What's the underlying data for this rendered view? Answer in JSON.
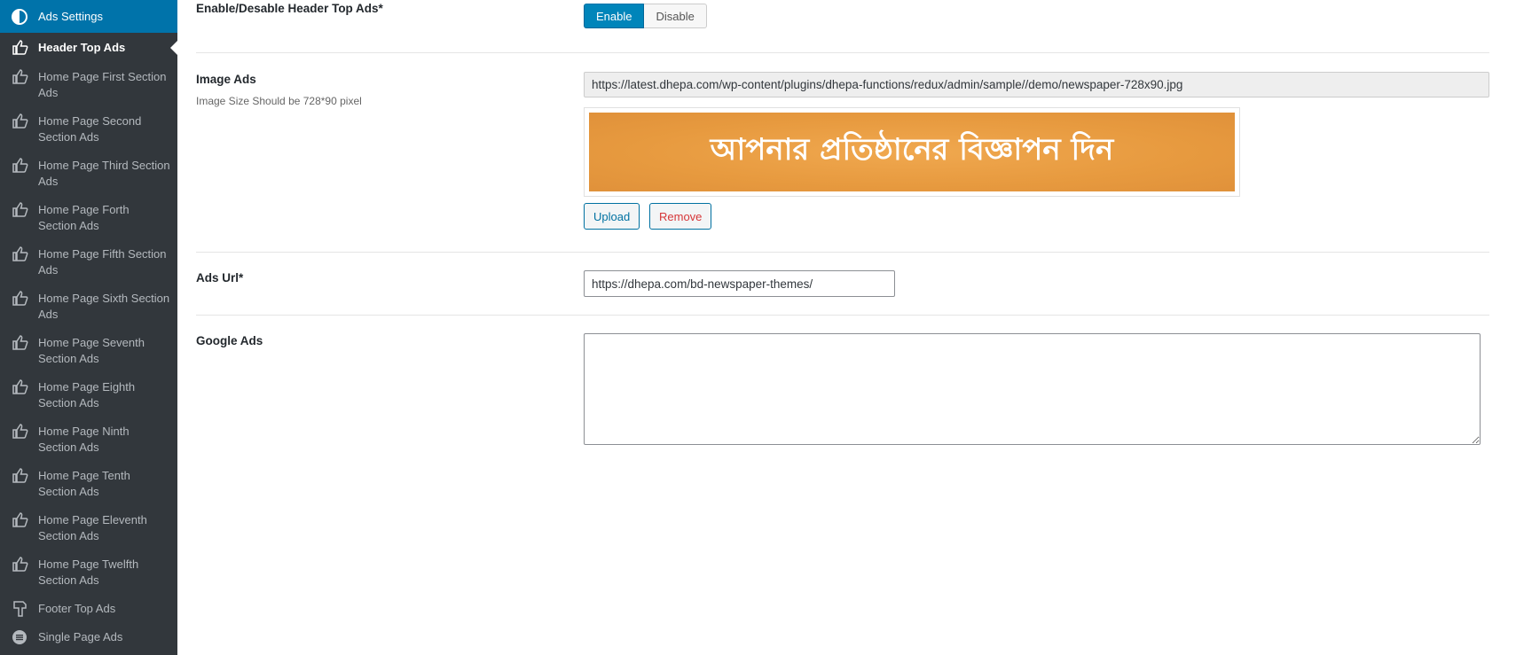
{
  "sidebar": {
    "header": {
      "label": "Ads Settings",
      "icon": "half-circle-icon"
    },
    "items": [
      {
        "label": "Header Top Ads",
        "icon": "thumb-pointer-icon",
        "active": true
      },
      {
        "label": "Home Page First Section Ads",
        "icon": "thumb-pointer-icon"
      },
      {
        "label": "Home Page Second Section Ads",
        "icon": "thumb-pointer-icon"
      },
      {
        "label": "Home Page Third Section Ads",
        "icon": "thumb-pointer-icon"
      },
      {
        "label": "Home Page Forth Section Ads",
        "icon": "thumb-pointer-icon"
      },
      {
        "label": "Home Page Fifth Section Ads",
        "icon": "thumb-pointer-icon"
      },
      {
        "label": "Home Page Sixth Section Ads",
        "icon": "thumb-pointer-icon"
      },
      {
        "label": "Home Page Seventh Section Ads",
        "icon": "thumb-pointer-icon"
      },
      {
        "label": "Home Page Eighth Section Ads",
        "icon": "thumb-pointer-icon"
      },
      {
        "label": "Home Page Ninth Section Ads",
        "icon": "thumb-pointer-icon"
      },
      {
        "label": "Home Page Tenth Section Ads",
        "icon": "thumb-pointer-icon"
      },
      {
        "label": "Home Page Eleventh Section Ads",
        "icon": "thumb-pointer-icon"
      },
      {
        "label": "Home Page Twelfth Section Ads",
        "icon": "thumb-pointer-icon"
      },
      {
        "label": "Footer Top Ads",
        "icon": "thumb-down-pointer-icon"
      },
      {
        "label": "Single Page Ads",
        "icon": "list-circle-icon"
      }
    ]
  },
  "fields": {
    "enable": {
      "title": "Enable/Desable Header Top Ads*",
      "enable_label": "Enable",
      "disable_label": "Disable",
      "selected": "Enable"
    },
    "image": {
      "title": "Image Ads",
      "subtitle": "Image Size Should be 728*90 pixel",
      "url": "https://latest.dhepa.com/wp-content/plugins/dhepa-functions/redux/admin/sample//demo/newspaper-728x90.jpg",
      "banner_text": "আপনার প্রতিষ্ঠানের বিজ্ঞাপন দিন",
      "upload_label": "Upload",
      "remove_label": "Remove"
    },
    "ads_url": {
      "title": "Ads Url*",
      "value": "https://dhepa.com/bd-newspaper-themes/"
    },
    "google": {
      "title": "Google Ads",
      "value": ""
    }
  },
  "colors": {
    "sidebar_bg": "#32373c",
    "sidebar_header_bg": "#0073aa",
    "accent": "#0085ba",
    "banner_bg": "#e79a3f"
  }
}
